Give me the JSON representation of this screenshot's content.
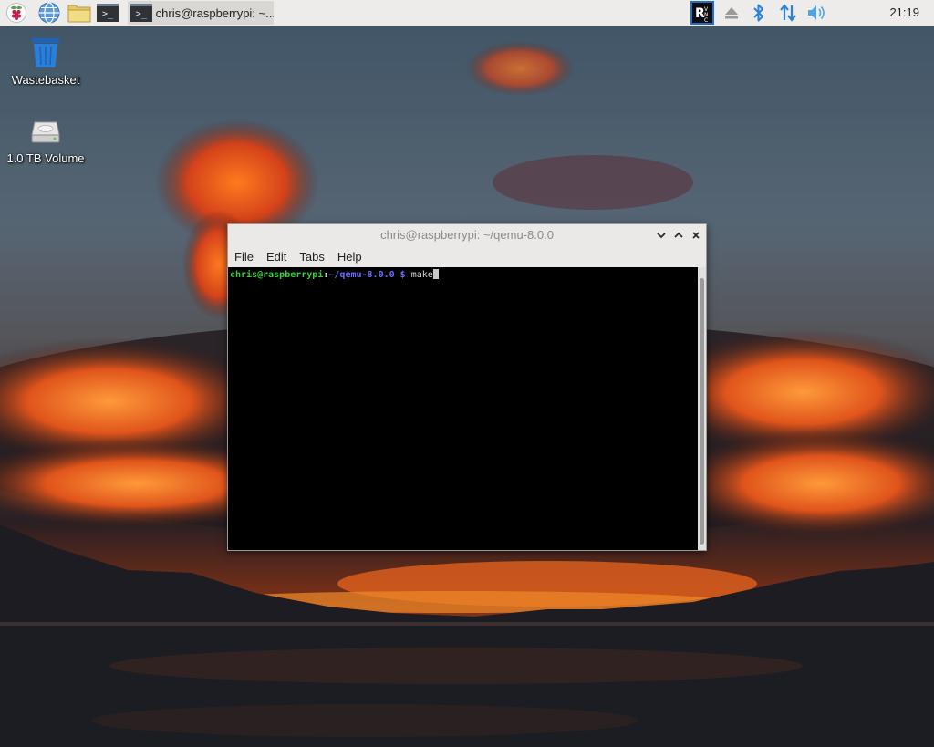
{
  "taskbar": {
    "launchers": [
      {
        "icon": "raspberry-menu-icon"
      },
      {
        "icon": "web-browser-icon"
      },
      {
        "icon": "file-manager-icon"
      },
      {
        "icon": "terminal-icon"
      }
    ],
    "active_task": {
      "icon": "terminal-icon",
      "label": "chris@raspberrypi: ~..."
    },
    "tray": {
      "icons": [
        "vnc-icon",
        "eject-icon",
        "bluetooth-icon",
        "network-icon",
        "volume-icon"
      ],
      "clock": "21:19"
    }
  },
  "desktop": {
    "icons": [
      {
        "icon": "wastebasket-icon",
        "label": "Wastebasket"
      },
      {
        "icon": "drive-icon",
        "label": "1.0 TB Volume"
      }
    ]
  },
  "terminal_window": {
    "title": "chris@raspberrypi: ~/qemu-8.0.0",
    "menu": [
      "File",
      "Edit",
      "Tabs",
      "Help"
    ],
    "prompt": {
      "user_host": "chris@raspberrypi",
      "colon": ":",
      "path": "~/qemu-8.0.0",
      "symbol": " $ ",
      "command": "make"
    },
    "buttons": {
      "minimize": "⌄",
      "maximize": "⌃",
      "close": "×"
    }
  },
  "colors": {
    "taskbar_bg": "#edeceb",
    "prompt_user": "#33d333",
    "prompt_path": "#6b6bff",
    "terminal_bg": "#000000",
    "tray_accent": "#2b82d9"
  }
}
